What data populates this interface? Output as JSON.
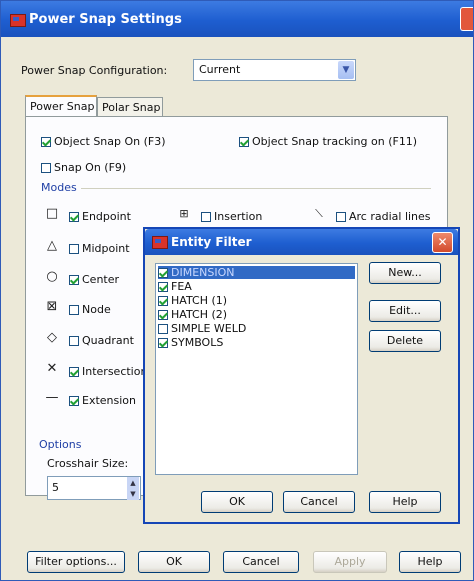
{
  "main": {
    "title": "Power Snap Settings",
    "config_label": "Power Snap Configuration:",
    "config_value": "Current",
    "tabs": [
      {
        "label": "Power Snap",
        "active": true
      },
      {
        "label": "Polar Snap",
        "active": false
      }
    ],
    "object_snap_on": {
      "label": "Object Snap On (F3)",
      "checked": true
    },
    "object_snap_tracking": {
      "label": "Object Snap tracking on (F11)",
      "checked": true
    },
    "snap_on": {
      "label": "Snap On (F9)",
      "checked": false
    },
    "modes_label": "Modes",
    "modes": [
      {
        "label": "Endpoint",
        "checked": true,
        "symbol": "square"
      },
      {
        "label": "Midpoint",
        "checked": false,
        "symbol": "triangle"
      },
      {
        "label": "Center",
        "checked": true,
        "symbol": "circle"
      },
      {
        "label": "Node",
        "checked": false,
        "symbol": "node"
      },
      {
        "label": "Quadrant",
        "checked": false,
        "symbol": "diamond"
      },
      {
        "label": "Intersection",
        "checked": true,
        "symbol": "cross"
      },
      {
        "label": "Extension",
        "checked": true,
        "symbol": "dash"
      }
    ],
    "insertion": {
      "label": "Insertion",
      "checked": false
    },
    "arc_radial_lines": {
      "label": "Arc radial lines",
      "checked": false
    },
    "options_label": "Options",
    "crosshair_label": "Crosshair Size:",
    "crosshair_value": "5",
    "buttons": {
      "filter_options": "Filter options...",
      "ok": "OK",
      "cancel": "Cancel",
      "apply": "Apply",
      "help": "Help"
    }
  },
  "entity_filter": {
    "title": "Entity Filter",
    "items": [
      {
        "label": "DIMENSION",
        "checked": true,
        "selected": true
      },
      {
        "label": "FEA",
        "checked": true,
        "selected": false
      },
      {
        "label": "HATCH (1)",
        "checked": true,
        "selected": false
      },
      {
        "label": "HATCH (2)",
        "checked": true,
        "selected": false
      },
      {
        "label": "SIMPLE WELD",
        "checked": false,
        "selected": false
      },
      {
        "label": "SYMBOLS",
        "checked": true,
        "selected": false
      }
    ],
    "buttons": {
      "new": "New...",
      "edit": "Edit...",
      "delete": "Delete",
      "ok": "OK",
      "cancel": "Cancel",
      "help": "Help"
    }
  },
  "colors": {
    "titlebar": "#1e5ed0",
    "dialog_bg": "#ece9d8",
    "selection": "#316ac5"
  }
}
